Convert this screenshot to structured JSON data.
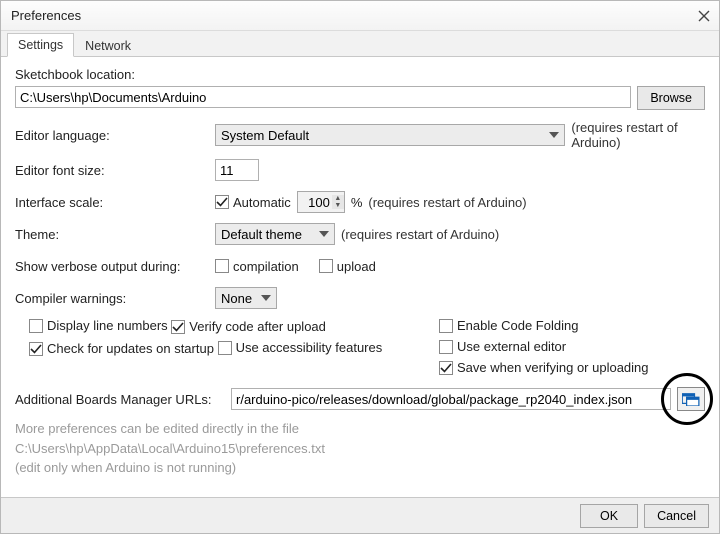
{
  "window": {
    "title": "Preferences"
  },
  "tabs": {
    "settings": "Settings",
    "network": "Network"
  },
  "labels": {
    "sketchbook": "Sketchbook location:",
    "browse": "Browse",
    "editor_language": "Editor language:",
    "requires_restart": "(requires restart of Arduino)",
    "editor_font_size": "Editor font size:",
    "interface_scale": "Interface scale:",
    "automatic": "Automatic",
    "percent": "%",
    "theme": "Theme:",
    "verbose": "Show verbose output during:",
    "compilation": "compilation",
    "upload": "upload",
    "compiler_warnings": "Compiler warnings:",
    "display_line_numbers": "Display line numbers",
    "enable_code_folding": "Enable Code Folding",
    "verify_code": "Verify code after upload",
    "use_external_editor": "Use external editor",
    "check_updates": "Check for updates on startup",
    "save_when_verifying": "Save when verifying or uploading",
    "use_accessibility": "Use accessibility features",
    "additional_urls": "Additional Boards Manager URLs:",
    "more_prefs": "More preferences can be edited directly in the file",
    "edit_only": "(edit only when Arduino is not running)"
  },
  "values": {
    "sketchbook_path": "C:\\Users\\hp\\Documents\\Arduino",
    "language": "System Default",
    "font_size": "11",
    "scale": "100",
    "theme": "Default theme",
    "compiler_warnings": "None",
    "urls": "r/arduino-pico/releases/download/global/package_rp2040_index.json",
    "prefs_path": "C:\\Users\\hp\\AppData\\Local\\Arduino15\\preferences.txt"
  },
  "checks": {
    "automatic_scale": true,
    "compilation": false,
    "upload": false,
    "display_line_numbers": false,
    "enable_code_folding": false,
    "verify_code": true,
    "use_external_editor": false,
    "check_updates": true,
    "save_when_verifying": true,
    "use_accessibility": false
  },
  "buttons": {
    "ok": "OK",
    "cancel": "Cancel"
  }
}
